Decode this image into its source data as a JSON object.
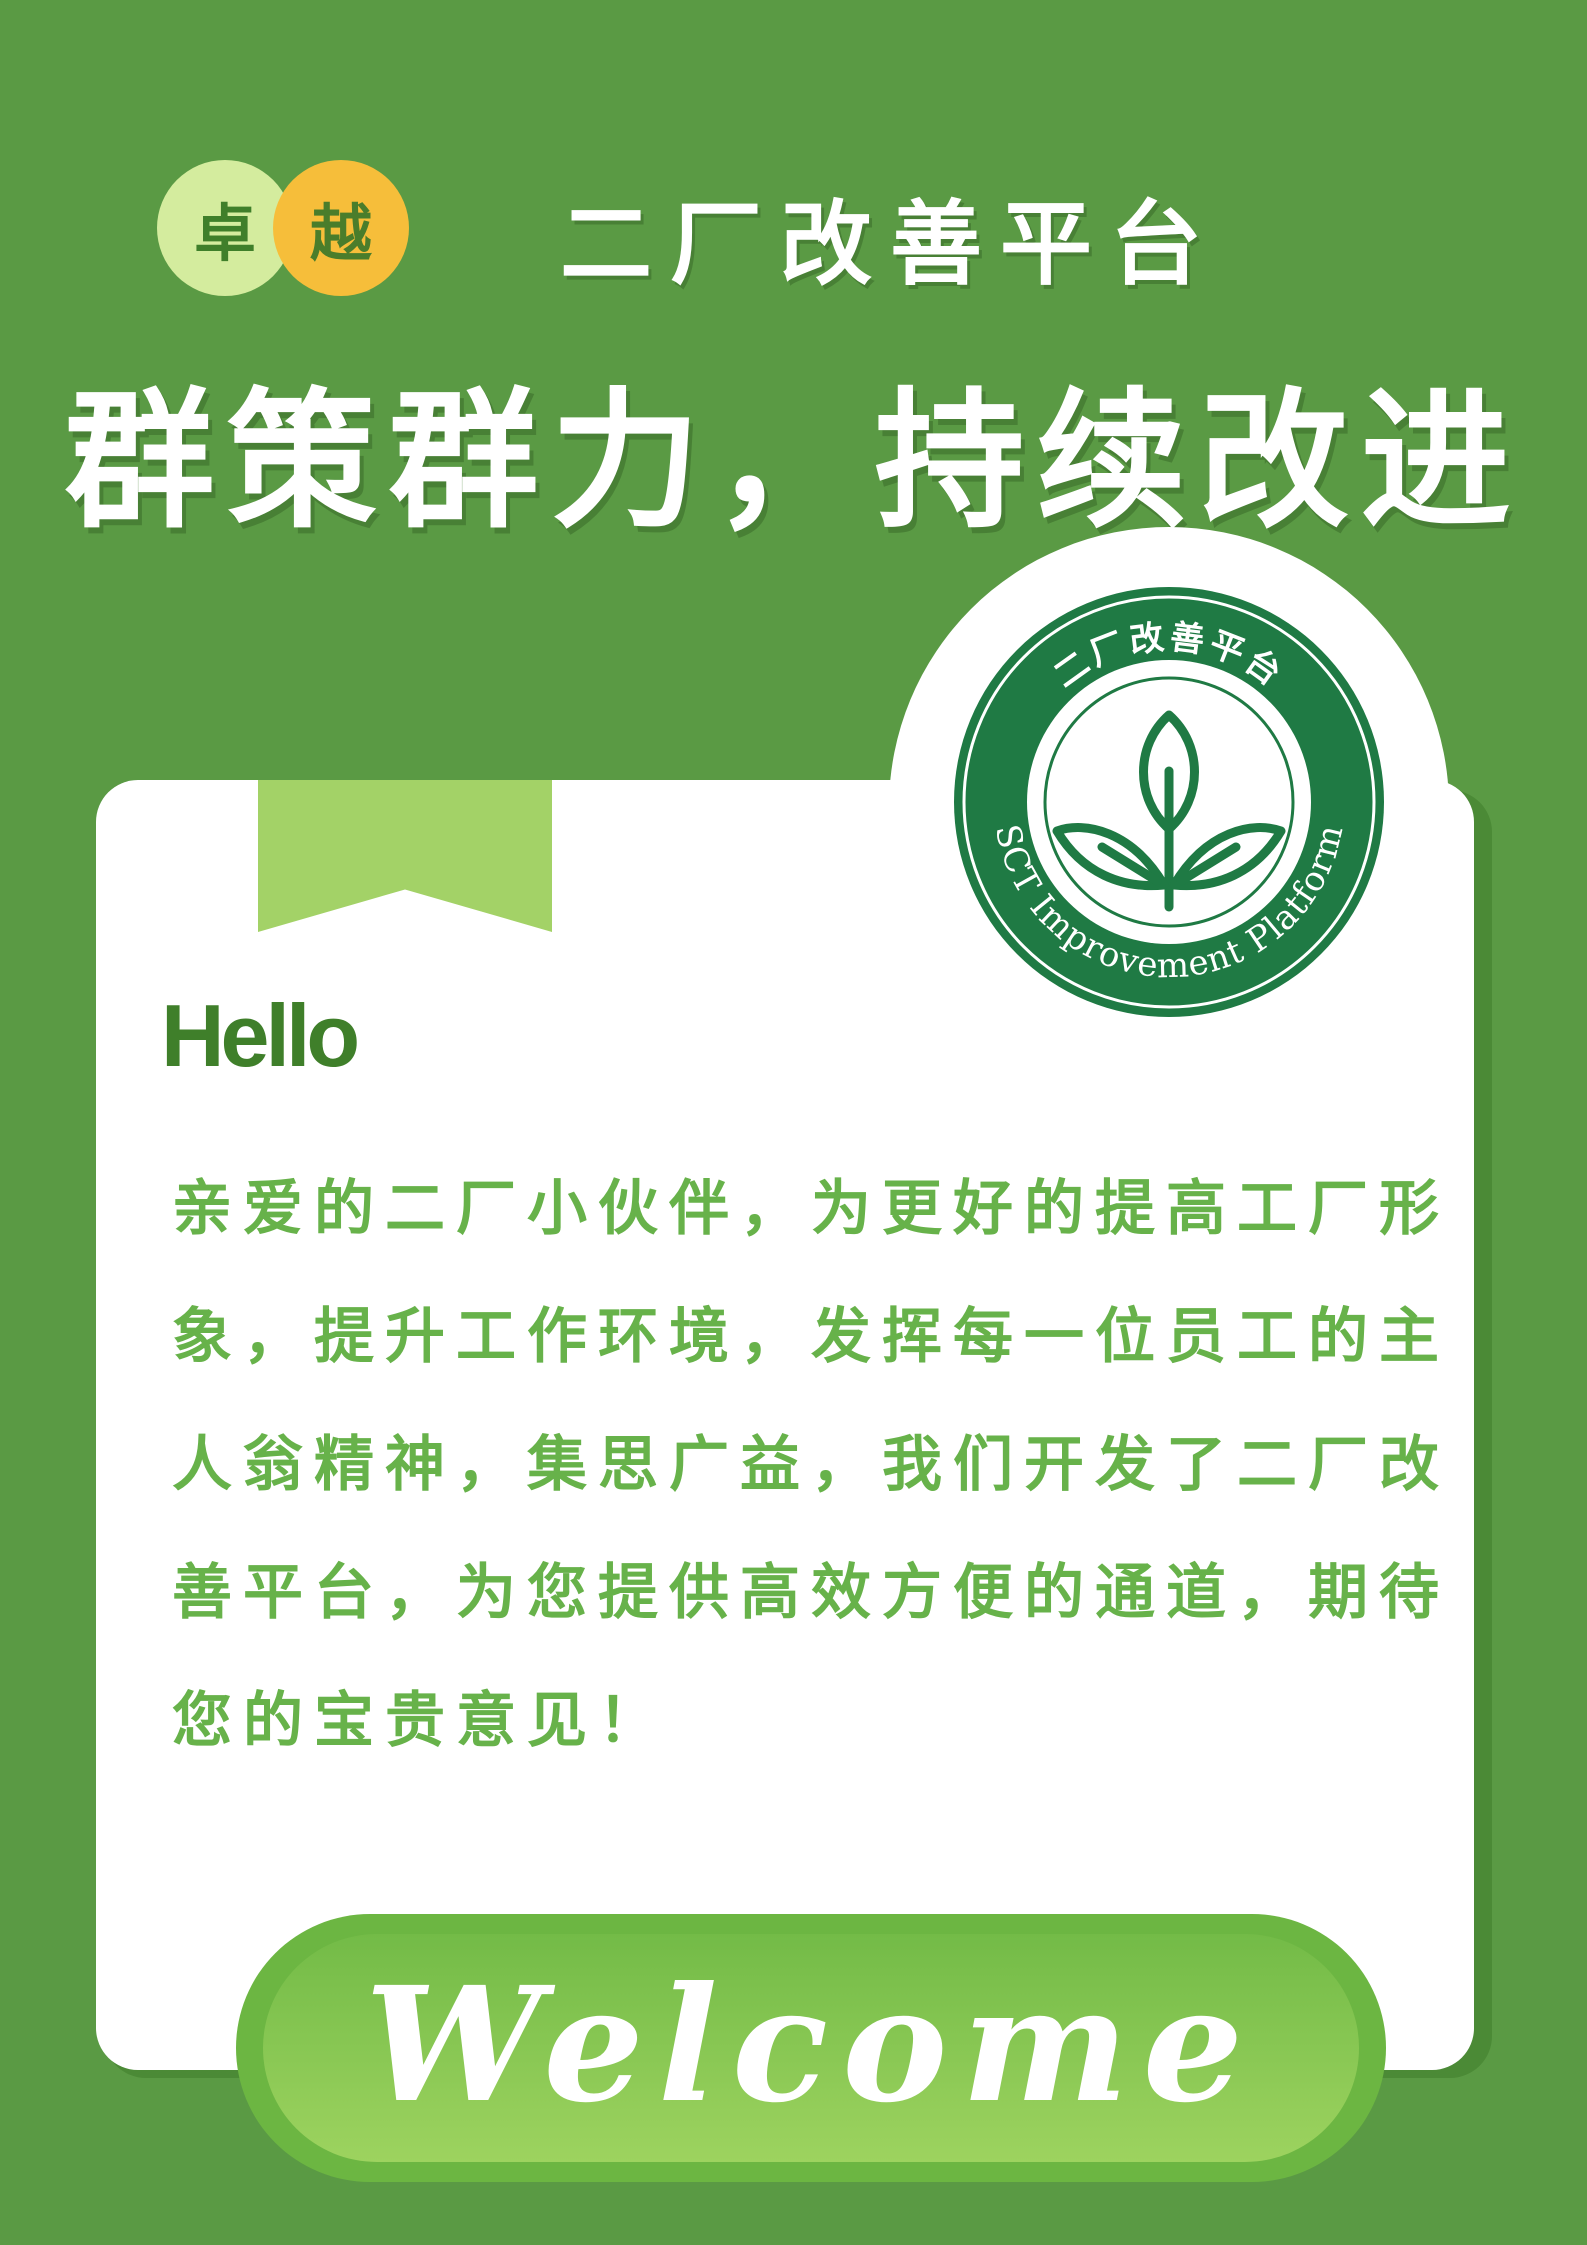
{
  "badges": [
    "卓",
    "越"
  ],
  "platform_title": "二厂改善平台",
  "slogan": "群策群力，持续改进",
  "logo": {
    "top_text": "二厂改善平台",
    "bottom_text": "SCT Improvement Platform",
    "icon": "leaf-sprout-icon"
  },
  "card": {
    "greeting": "Hello",
    "message": "亲爱的二厂小伙伴，为更好的提高工厂形象，提升工作环境，发挥每一位员工的主人翁精神，集思广益，我们开发了二厂改善平台，为您提供高效方便的通道，期待您的宝贵意见！"
  },
  "welcome": "Welcome",
  "colors": {
    "background": "#5a9a44",
    "card": "#ffffff",
    "dark_green": "#1f7a44",
    "text_green": "#67b24a",
    "badge_light": "#d4ec9e",
    "badge_yellow": "#f6be3a",
    "ribbon": "#a3d267"
  }
}
